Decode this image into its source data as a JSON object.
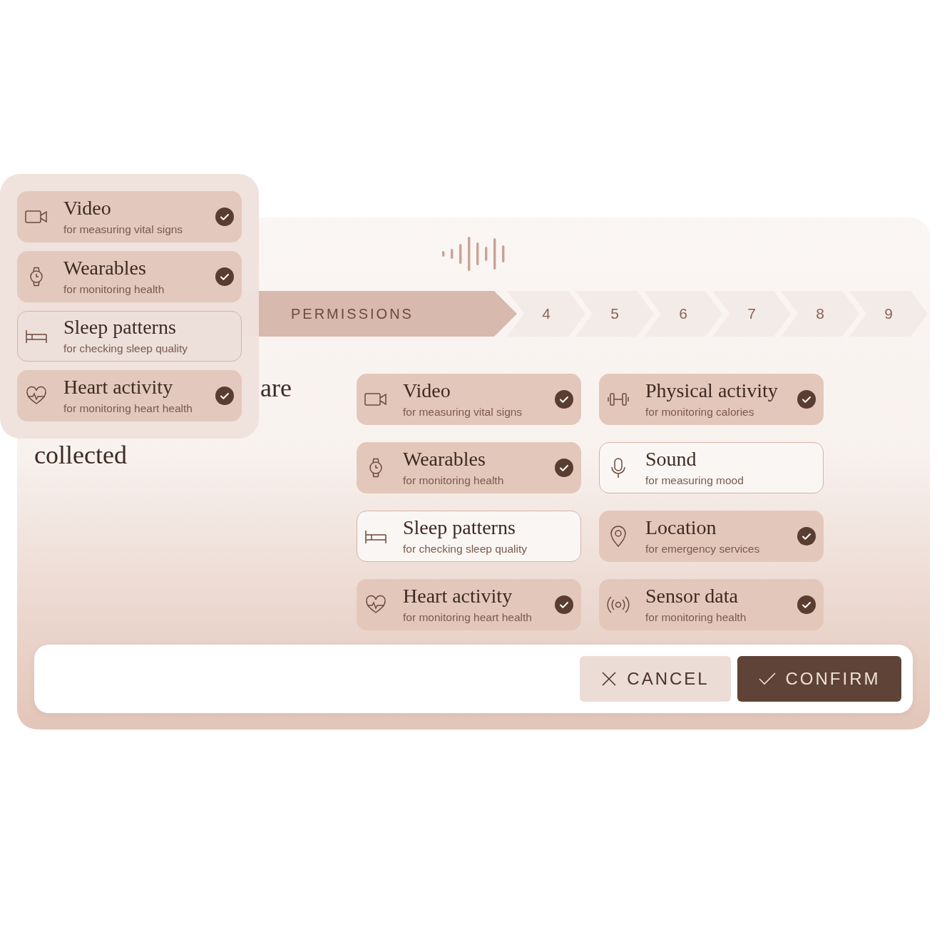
{
  "stepper": [
    {
      "label": "PERMISSIONS",
      "selected": true
    },
    {
      "label": "4",
      "selected": false
    },
    {
      "label": "5",
      "selected": false
    },
    {
      "label": "6",
      "selected": false
    },
    {
      "label": "7",
      "selected": false
    },
    {
      "label": "8",
      "selected": false
    },
    {
      "label": "9",
      "selected": false
    }
  ],
  "heading": [
    "are",
    "collected"
  ],
  "permissions": [
    {
      "kind": "video",
      "title": "Video",
      "subtitle": "for measuring vital signs",
      "checked": true
    },
    {
      "kind": "dumbbell",
      "title": "Physical activity",
      "subtitle": "for monitoring calories",
      "checked": true
    },
    {
      "kind": "watch",
      "title": "Wearables",
      "subtitle": "for monitoring health",
      "checked": true
    },
    {
      "kind": "mic",
      "title": "Sound",
      "subtitle": "for measuring mood",
      "checked": false
    },
    {
      "kind": "bed",
      "title": "Sleep patterns",
      "subtitle": "for checking sleep quality",
      "checked": false
    },
    {
      "kind": "pin",
      "title": "Location",
      "subtitle": "for emergency services",
      "checked": true
    },
    {
      "kind": "heart",
      "title": "Heart activity",
      "subtitle": "for monitoring heart health",
      "checked": true
    },
    {
      "kind": "signal",
      "title": "Sensor data",
      "subtitle": "for monitoring health",
      "checked": true
    }
  ],
  "buttons": [
    {
      "kind": "cancel",
      "label": "CANCEL"
    },
    {
      "kind": "confirm",
      "label": "CONFIRM"
    }
  ],
  "overlay": {
    "permissions": [
      {
        "kind": "video",
        "title": "Video",
        "subtitle": "for measuring vital signs",
        "checked": true
      },
      {
        "kind": "watch",
        "title": "Wearables",
        "subtitle": "for monitoring health",
        "checked": true
      },
      {
        "kind": "bed",
        "title": "Sleep patterns",
        "subtitle": "for checking sleep quality",
        "checked": false
      },
      {
        "kind": "heart",
        "title": "Heart activity",
        "subtitle": "for monitoring heart health",
        "checked": true
      }
    ]
  }
}
